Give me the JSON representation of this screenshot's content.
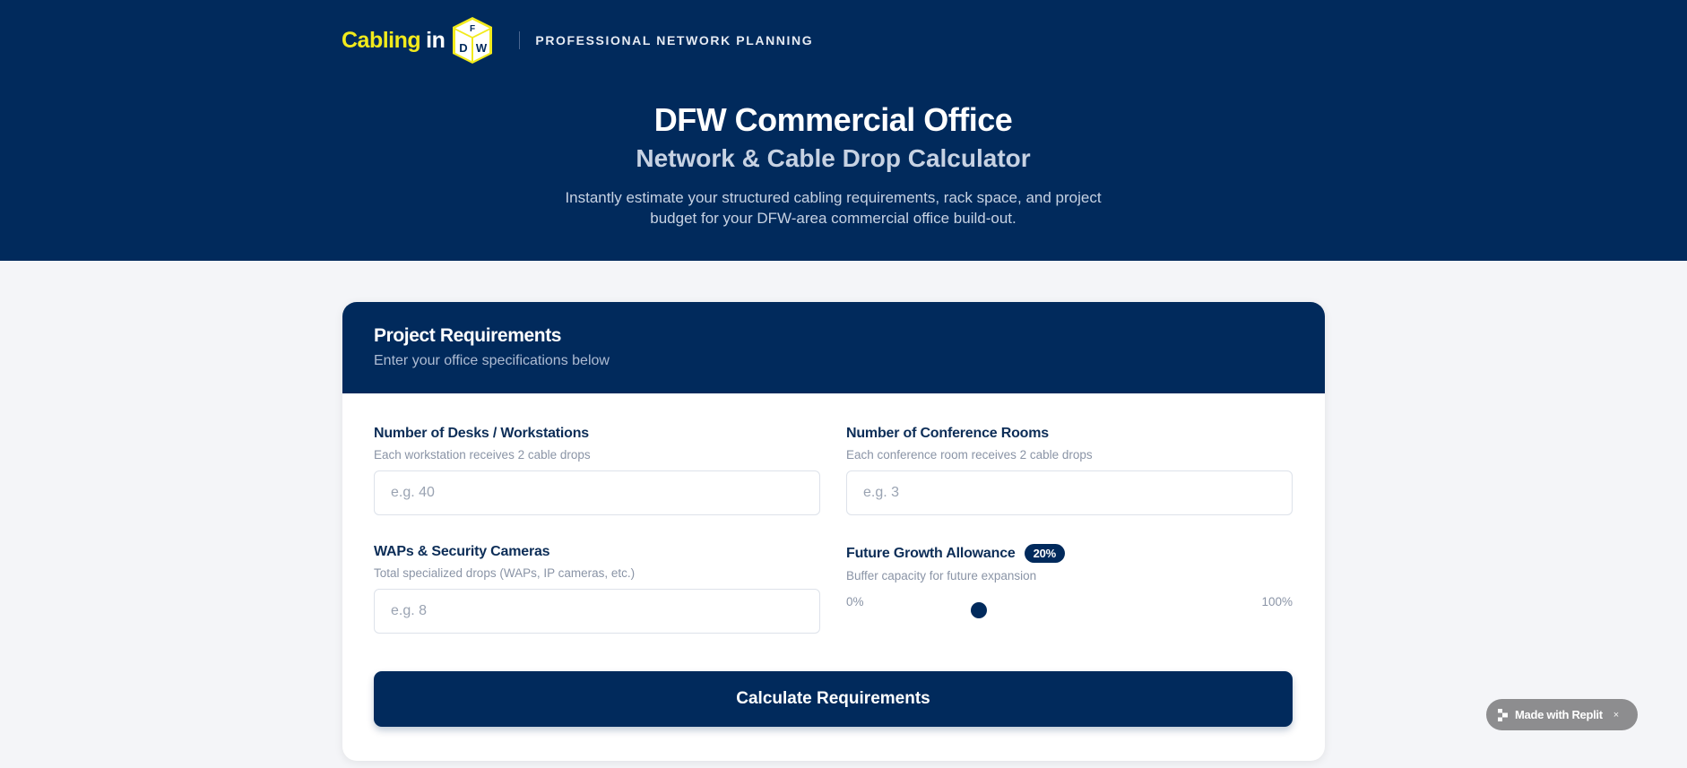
{
  "header": {
    "logo_text_main": "Cabling",
    "logo_text_in": "in",
    "logo_cube_text": "DFW",
    "tagline": "PROFESSIONAL NETWORK PLANNING",
    "title": "DFW Commercial Office",
    "subtitle": "Network & Cable Drop Calculator",
    "description_line1": "Instantly estimate your structured cabling requirements, rack space, and project",
    "description_line2": "budget for your DFW-area commercial office build-out."
  },
  "card": {
    "title": "Project Requirements",
    "subtitle": "Enter your office specifications below"
  },
  "fields": {
    "desks": {
      "label": "Number of Desks / Workstations",
      "help": "Each workstation receives 2 cable drops",
      "placeholder": "e.g. 40",
      "value": ""
    },
    "conference": {
      "label": "Number of Conference Rooms",
      "help": "Each conference room receives 2 cable drops",
      "placeholder": "e.g. 3",
      "value": ""
    },
    "waps": {
      "label": "WAPs & Security Cameras",
      "help": "Total specialized drops (WAPs, IP cameras, etc.)",
      "placeholder": "e.g. 8",
      "value": ""
    },
    "growth": {
      "label": "Future Growth Allowance",
      "badge": "20%",
      "help": "Buffer capacity for future expansion",
      "min_label": "0%",
      "max_label": "100%",
      "value_fraction": 0.2
    }
  },
  "calculate_button_label": "Calculate Requirements",
  "replit_badge": {
    "label": "Made with Replit",
    "close": "×"
  },
  "colors": {
    "navy": "#012a5c",
    "logo_yellow": "#f2ea1c",
    "page_bg": "#f4f5f8"
  }
}
